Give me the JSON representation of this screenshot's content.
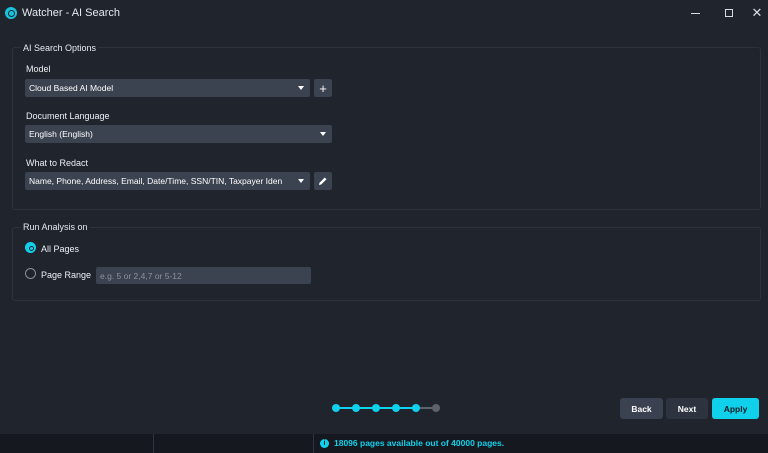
{
  "window": {
    "title": "Watcher - AI Search",
    "icons": {
      "app": "watcher-logo-icon",
      "minimize": "minimize-icon",
      "maximize": "maximize-icon",
      "close": "close-icon"
    }
  },
  "ai_options": {
    "group_label": "AI Search Options",
    "model": {
      "label": "Model",
      "value": "Cloud Based AI Model",
      "add_icon": "plus-icon"
    },
    "language": {
      "label": "Document Language",
      "value": "English (English)"
    },
    "redact": {
      "label": "What to Redact",
      "value": "Name, Phone, Address, Email, Date/Time, SSN/TIN, Taxpayer Iden",
      "edit_icon": "pencil-icon"
    }
  },
  "run_analysis": {
    "group_label": "Run Analysis on",
    "all_pages": {
      "label": "All Pages",
      "selected": true
    },
    "page_range": {
      "label": "Page Range",
      "selected": false,
      "placeholder": "e.g. 5 or 2,4,7 or 5-12",
      "value": ""
    }
  },
  "wizard": {
    "total_steps": 6,
    "current_step": 5,
    "active_color": "#10d1ec",
    "inactive_color": "#5d626b"
  },
  "buttons": {
    "back": "Back",
    "next": "Next",
    "apply": "Apply"
  },
  "status": {
    "icon": "info-icon",
    "text": "18096 pages available out of 40000 pages."
  },
  "colors": {
    "accent": "#10d1ec",
    "background": "#1f242d",
    "control": "#3b4250",
    "statusbar": "#15191f"
  }
}
